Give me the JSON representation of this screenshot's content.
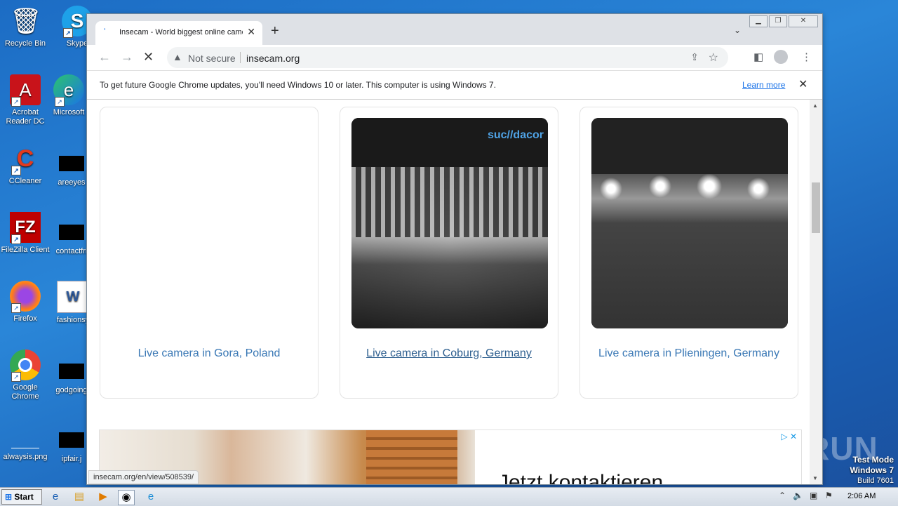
{
  "desktop": {
    "icons": [
      {
        "label": "Recycle Bin",
        "glyph": "🗑"
      },
      {
        "label": "Skype",
        "glyph": "S"
      },
      {
        "label": "Acrobat Reader DC",
        "glyph": "A"
      },
      {
        "label": "Microsoft",
        "glyph": "e"
      },
      {
        "label": "CCleaner",
        "glyph": "C"
      },
      {
        "label": "areeyes",
        "glyph": ""
      },
      {
        "label": "FileZilla Client",
        "glyph": "FZ"
      },
      {
        "label": "contactfri",
        "glyph": ""
      },
      {
        "label": "Firefox",
        "glyph": "🦊"
      },
      {
        "label": "fashionsy",
        "glyph": "W"
      },
      {
        "label": "Google Chrome",
        "glyph": "◉"
      },
      {
        "label": "godgoing",
        "glyph": ""
      },
      {
        "label": "alwaysis.png",
        "glyph": ""
      },
      {
        "label": "ipfair.j",
        "glyph": ""
      }
    ]
  },
  "browser": {
    "tab_title": "Insecam - World biggest online came",
    "url_security": "Not secure",
    "url": "insecam.org",
    "infobar_message": "To get future Google Chrome updates, you'll need Windows 10 or later. This computer is using Windows 7.",
    "infobar_link": "Learn more",
    "status_url": "insecam.org/en/view/508539/"
  },
  "page": {
    "cameras": [
      {
        "label": "Live camera in Gora, Poland"
      },
      {
        "label": "Live camera in Coburg, Germany"
      },
      {
        "label": "Live camera in Plieningen, Germany"
      }
    ],
    "cam_logo": "suc//dacor",
    "ad_text": "Jetzt kontaktieren"
  },
  "watermark": {
    "brand": "ANY RUN",
    "mode_line1": "Test Mode",
    "mode_line2": "Windows 7",
    "mode_line3": "Build 7601"
  },
  "taskbar": {
    "start_label": "Start",
    "clock": "2:06 AM"
  }
}
